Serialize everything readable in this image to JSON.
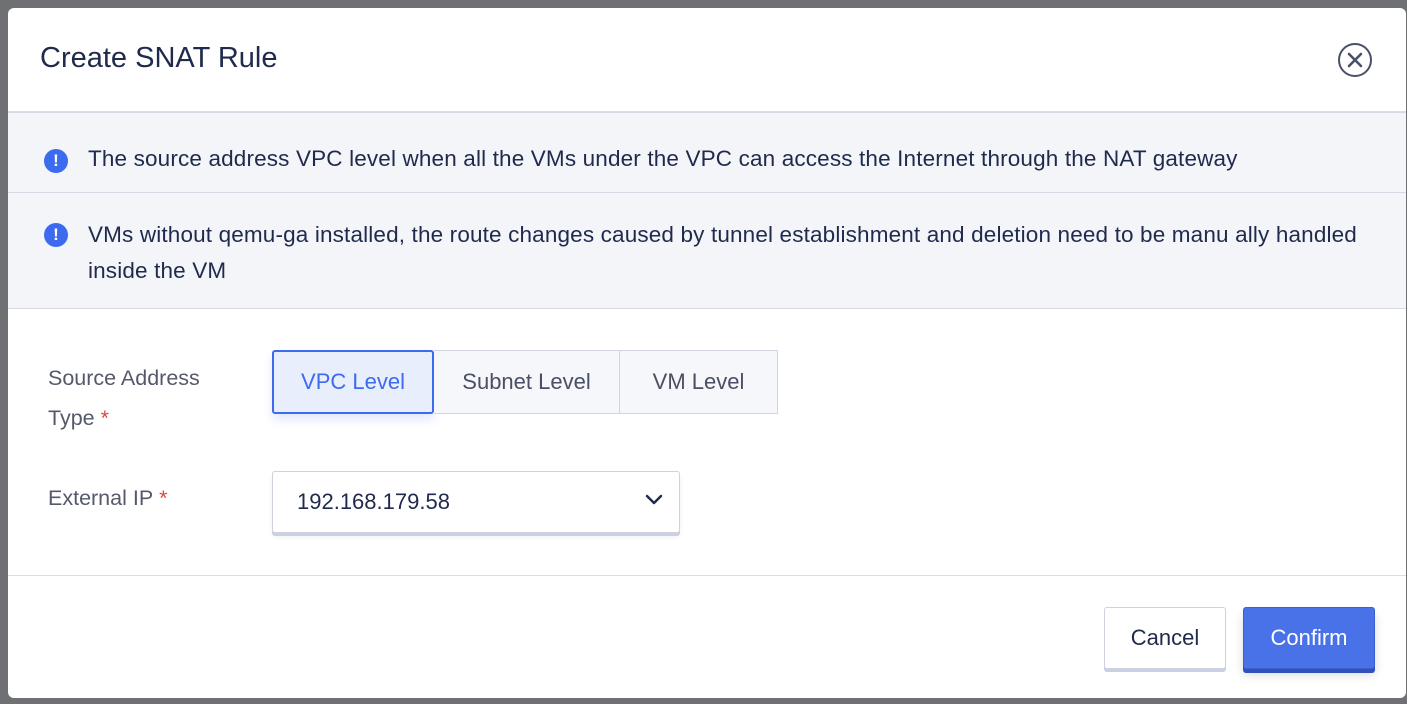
{
  "dialog": {
    "title": "Create SNAT Rule"
  },
  "alerts": [
    {
      "icon": "info-icon",
      "text": "The source address VPC level when all the VMs under the VPC can access the Internet through the NAT gateway"
    },
    {
      "icon": "info-icon",
      "text": "VMs without qemu-ga installed, the route changes caused by tunnel establishment and deletion need to be manu ally handled inside the VM"
    }
  ],
  "form": {
    "source_address_type": {
      "label": "Source Address Type",
      "required_mark": "*",
      "options": [
        "VPC Level",
        "Subnet Level",
        "VM Level"
      ],
      "selected": "VPC Level"
    },
    "external_ip": {
      "label": "External IP",
      "required_mark": "*",
      "value": "192.168.179.58"
    }
  },
  "footer": {
    "cancel_label": "Cancel",
    "confirm_label": "Confirm"
  },
  "colors": {
    "accent": "#3d6bf0",
    "confirm_bg": "#4a72e8",
    "required": "#e0483a",
    "alert_bg": "#f4f5f9"
  }
}
